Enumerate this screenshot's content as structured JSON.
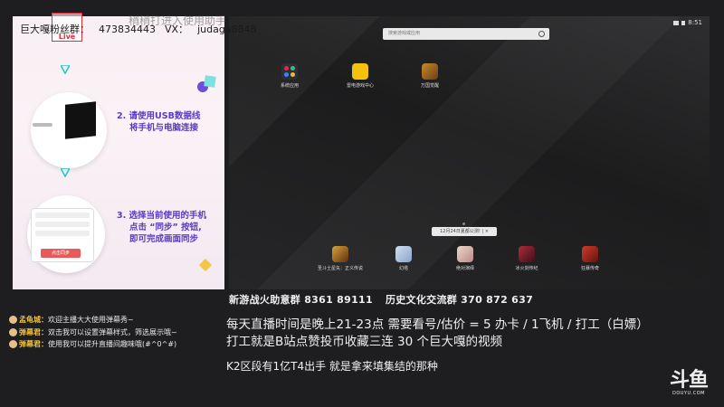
{
  "overlay": {
    "qq_label": "巨大嘎粉丝群：",
    "qq_number": "473834443",
    "vx_label": "VX：",
    "vx_id": "judaga8848",
    "live": "Live",
    "blurred_top": "稍稍打进入使用助手"
  },
  "guide": {
    "step2": [
      "2. 请使用USB数据线",
      "将手机与电脑连接"
    ],
    "step3": [
      "3. 选择当前使用的手机",
      "点击 “同步” 按钮,",
      "即可完成画面同步"
    ],
    "phone_button": "点击同步"
  },
  "emulator": {
    "time": "8:51",
    "search_placeholder": "搜索游戏或应用",
    "apps_top": [
      "系统应用",
      "雷电游戏中心",
      "万国觉醒"
    ],
    "apps_bottom": [
      "圣斗士星矢：正义传说",
      "幻塔",
      "绝对演绎",
      "冰火剑传纪",
      "狂暴传奇"
    ],
    "date_pill": "12月24日夏都公测!"
  },
  "group_line": {
    "g1": "新游战火助意群 8361 89111",
    "g2": "历史文化交流群 370 872 637"
  },
  "chat": [
    {
      "name": "孟龟城：",
      "text": "欢迎主播大大使用弹幕秀~"
    },
    {
      "name": "弹幕君：",
      "text": "双击我可以设置弹幕样式，筛选展示哦~"
    },
    {
      "name": "弹幕君：",
      "text": "使用我可以提升直播间趣味哦(#^0^#)"
    }
  ],
  "big": {
    "line1": "每天直播时间是晚上21-23点     需要看号/估价 = 5 办卡 / 1飞机 / 打工（白嫖）",
    "line2": "打工就是B站点赞投币收藏三连 30 个巨大嘎的视频",
    "line3": "K2区段有1亿T4出手  就是拿来填集结的那种"
  },
  "logo": {
    "mark": "斗鱼",
    "sub": "DOUYU.COM"
  },
  "colors": {
    "accent_purple": "#5a3ac8",
    "chat_name": "#f3c13a",
    "live_red": "#e03040"
  }
}
